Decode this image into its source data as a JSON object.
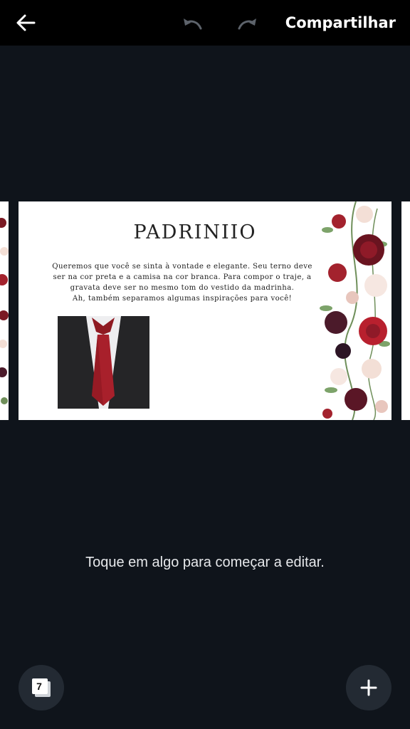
{
  "toolbar": {
    "back_icon": "arrow-left-icon",
    "undo_icon": "undo-icon",
    "redo_icon": "redo-icon",
    "share_label": "Compartilhar"
  },
  "page": {
    "title": "PADRINIIO",
    "body_lines": [
      "Queremos que você se sinta à vontade e elegante. Seu terno deve",
      "ser na cor preta e a camisa na cor branca. Para compor o traje, a",
      "gravata deve ser no mesmo tom do vestido da madrinha.",
      "Ah, também separamos algumas inspirações para você!"
    ]
  },
  "hint": "Toque em algo para começar a editar.",
  "pages_button": {
    "count": "7",
    "icon": "pages-icon"
  },
  "add_button": {
    "icon": "plus-icon"
  },
  "colors": {
    "topbar_bg": "#000000",
    "workspace_bg": "#0f141b",
    "fab_bg": "#232a33",
    "flower_burgundy": "#7a1a24",
    "flower_blush": "#f3dfd6"
  }
}
